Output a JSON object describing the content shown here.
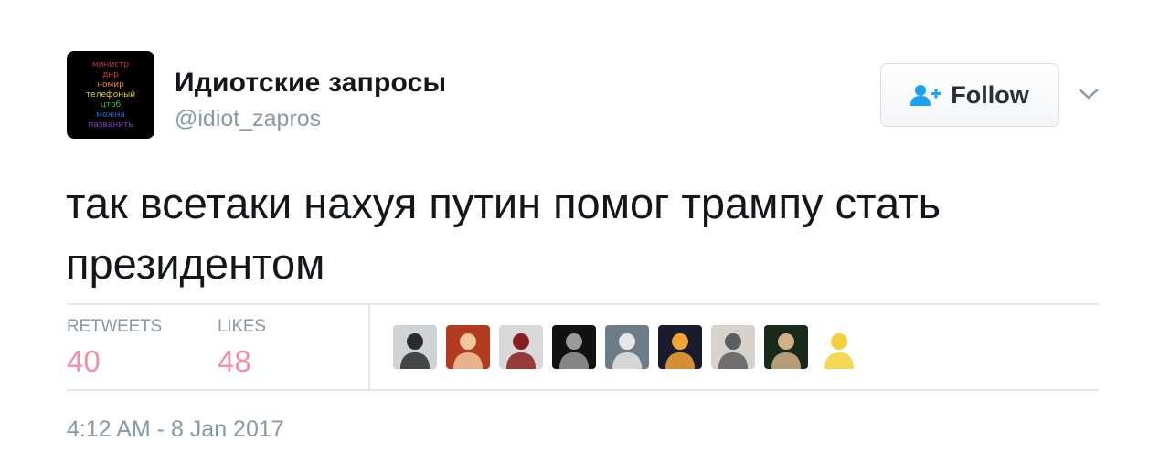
{
  "author": {
    "avatar_lines": [
      {
        "text": "министр",
        "color": "#c0334b"
      },
      {
        "text": "днр",
        "color": "#e03a2a"
      },
      {
        "text": "номир",
        "color": "#f08a1c"
      },
      {
        "text": "телефоный",
        "color": "#e8d41c"
      },
      {
        "text": "цтоб",
        "color": "#3fbf3f"
      },
      {
        "text": "можна",
        "color": "#2a6adf"
      },
      {
        "text": "пазванить",
        "color": "#8a3fcf"
      }
    ],
    "name": "Идиотские запросы",
    "handle": "@idiot_zapros"
  },
  "follow_button": {
    "label": "Follow",
    "icon": "add-user-icon",
    "accent": "#1da1f2"
  },
  "caret_icon": "chevron-down-icon",
  "tweet": {
    "text": "так всетаки нахуя путин помог трампу стать президентом"
  },
  "stats": {
    "retweets_label": "RETWEETS",
    "retweets_count": "40",
    "likes_label": "LIKES",
    "likes_count": "48",
    "count_color": "#f28fa8"
  },
  "likers": [
    {
      "bg": "#cfd3d6",
      "fg": "#2b2b2b"
    },
    {
      "bg": "#b23a1e",
      "fg": "#f0c9a0"
    },
    {
      "bg": "#d9d9d9",
      "fg": "#8a1d1d"
    },
    {
      "bg": "#111111",
      "fg": "#9a9a9a"
    },
    {
      "bg": "#6d7c86",
      "fg": "#e6e6e6"
    },
    {
      "bg": "#1b1b2e",
      "fg": "#f2a533"
    },
    {
      "bg": "#d8d2cc",
      "fg": "#5d5d5d"
    },
    {
      "bg": "#1a2a1a",
      "fg": "#d1b08a"
    },
    {
      "bg": "#ffffff",
      "fg": "#f2d23c"
    }
  ],
  "timestamp": "4:12 AM - 8 Jan 2017"
}
